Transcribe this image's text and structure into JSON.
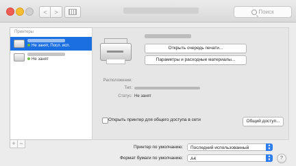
{
  "window": {
    "title_obscured": true,
    "search_placeholder": "Поиск",
    "nav_back": "<",
    "nav_forward": ">"
  },
  "sidebar": {
    "header": "Принтеры",
    "items": [
      {
        "name_obscured": true,
        "status": "Не занят, Посл. исп.",
        "selected": true
      },
      {
        "name_obscured": true,
        "status": "Не занят",
        "selected": false
      }
    ],
    "add_label": "+",
    "remove_label": "−"
  },
  "detail": {
    "open_queue_label": "Открыть очередь печати...",
    "supplies_label": "Параметры и расходные материалы...",
    "location_label": "Расположение:",
    "type_label": "Тип:",
    "status_label": "Статус:",
    "status_value": "Не занят",
    "share_label": "Открыть принтер для общего доступа в сети",
    "share_checked": false,
    "sharing_prefs_label": "Общий доступ..."
  },
  "defaults": {
    "default_printer_label": "Принтер по умолчанию:",
    "default_printer_value": "Последний использованный",
    "paper_size_label": "Формат бумаги по умолчанию:",
    "paper_size_value": "A4"
  },
  "help_label": "?",
  "colors": {
    "selection": "#1b6fe0",
    "status_green": "#6dbd3f",
    "popup_accent": "#2f7ef0"
  }
}
